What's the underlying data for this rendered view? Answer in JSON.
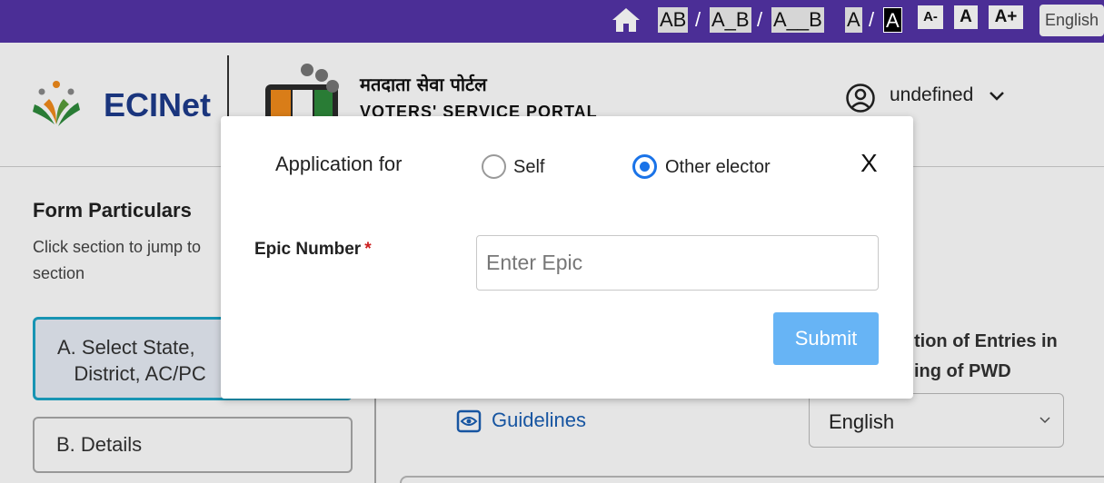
{
  "topbar": {
    "font_sizes": [
      "AB",
      "A_B",
      "A__B"
    ],
    "contrast_a": "A",
    "contrast_b": "A",
    "text_sizes": [
      "A-",
      "A",
      "A+"
    ],
    "language": "English",
    "home_icon": "home-icon"
  },
  "header": {
    "brand": "ECINet",
    "portal_hindi": "मतदाता सेवा पोर्टल",
    "portal_english": "VOTERS' SERVICE PORTAL",
    "user_name": "undefined"
  },
  "sidebar": {
    "title": "Form Particulars",
    "description": "Click section to jump to section",
    "items": [
      {
        "label": "A. Select State,\n   District, AC/PC"
      },
      {
        "label": "B. Details"
      }
    ]
  },
  "main": {
    "guidelines": "Guidelines",
    "correction_title": "tion of Entries in\ning of PWD",
    "language_select": "English"
  },
  "dialog": {
    "application_for": "Application for",
    "options": [
      {
        "label": "Self",
        "selected": false
      },
      {
        "label": "Other elector",
        "selected": true
      }
    ],
    "close": "X",
    "epic_label": "Epic Number",
    "required_mark": "*",
    "epic_placeholder": "Enter Epic",
    "submit": "Submit"
  },
  "colors": {
    "topbar": "#4b2e96",
    "brand": "#1e3c8c",
    "accent": "#1a73e8",
    "submit": "#67b4f5",
    "active_border": "#1aa5c8"
  }
}
